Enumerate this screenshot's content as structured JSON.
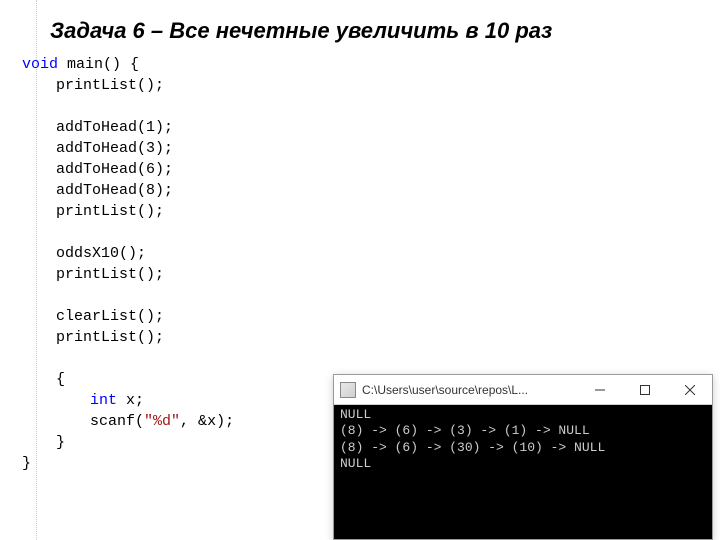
{
  "title": "Задача 6 – Все нечетные увеличить в 10 раз",
  "code": {
    "lines": [
      {
        "indent": 0,
        "tokens": [
          [
            "kw",
            "void"
          ],
          [
            "punct",
            " "
          ],
          [
            "fn",
            "main"
          ],
          [
            "punct",
            "() {"
          ]
        ]
      },
      {
        "indent": 1,
        "tokens": [
          [
            "fn",
            "printList"
          ],
          [
            "punct",
            "();"
          ]
        ]
      },
      {
        "indent": 1,
        "tokens": []
      },
      {
        "indent": 1,
        "tokens": [
          [
            "fn",
            "addToHead"
          ],
          [
            "punct",
            "("
          ],
          [
            "num",
            "1"
          ],
          [
            "punct",
            ");"
          ]
        ]
      },
      {
        "indent": 1,
        "tokens": [
          [
            "fn",
            "addToHead"
          ],
          [
            "punct",
            "("
          ],
          [
            "num",
            "3"
          ],
          [
            "punct",
            ");"
          ]
        ]
      },
      {
        "indent": 1,
        "tokens": [
          [
            "fn",
            "addToHead"
          ],
          [
            "punct",
            "("
          ],
          [
            "num",
            "6"
          ],
          [
            "punct",
            ");"
          ]
        ]
      },
      {
        "indent": 1,
        "tokens": [
          [
            "fn",
            "addToHead"
          ],
          [
            "punct",
            "("
          ],
          [
            "num",
            "8"
          ],
          [
            "punct",
            ");"
          ]
        ]
      },
      {
        "indent": 1,
        "tokens": [
          [
            "fn",
            "printList"
          ],
          [
            "punct",
            "();"
          ]
        ]
      },
      {
        "indent": 1,
        "tokens": []
      },
      {
        "indent": 1,
        "tokens": [
          [
            "fn",
            "oddsX10"
          ],
          [
            "punct",
            "();"
          ]
        ]
      },
      {
        "indent": 1,
        "tokens": [
          [
            "fn",
            "printList"
          ],
          [
            "punct",
            "();"
          ]
        ]
      },
      {
        "indent": 1,
        "tokens": []
      },
      {
        "indent": 1,
        "tokens": [
          [
            "fn",
            "clearList"
          ],
          [
            "punct",
            "();"
          ]
        ]
      },
      {
        "indent": 1,
        "tokens": [
          [
            "fn",
            "printList"
          ],
          [
            "punct",
            "();"
          ]
        ]
      },
      {
        "indent": 1,
        "tokens": []
      },
      {
        "indent": 1,
        "tokens": [
          [
            "punct",
            "{"
          ]
        ]
      },
      {
        "indent": 2,
        "tokens": [
          [
            "kw",
            "int"
          ],
          [
            "punct",
            " "
          ],
          [
            "id",
            "x"
          ],
          [
            "punct",
            ";"
          ]
        ]
      },
      {
        "indent": 2,
        "tokens": [
          [
            "fn",
            "scanf"
          ],
          [
            "punct",
            "("
          ],
          [
            "str",
            "\"%d\""
          ],
          [
            "punct",
            ", &"
          ],
          [
            "id",
            "x"
          ],
          [
            "punct",
            ");"
          ]
        ]
      },
      {
        "indent": 1,
        "tokens": [
          [
            "punct",
            "}"
          ]
        ]
      },
      {
        "indent": 0,
        "tokens": [
          [
            "punct",
            "}"
          ]
        ]
      }
    ]
  },
  "console": {
    "window_title": "C:\\Users\\user\\source\\repos\\L...",
    "controls": {
      "min": "minimize",
      "max": "maximize",
      "close": "close"
    },
    "output": [
      "NULL",
      "(8) -> (6) -> (3) -> (1) -> NULL",
      "(8) -> (6) -> (30) -> (10) -> NULL",
      "NULL"
    ]
  }
}
